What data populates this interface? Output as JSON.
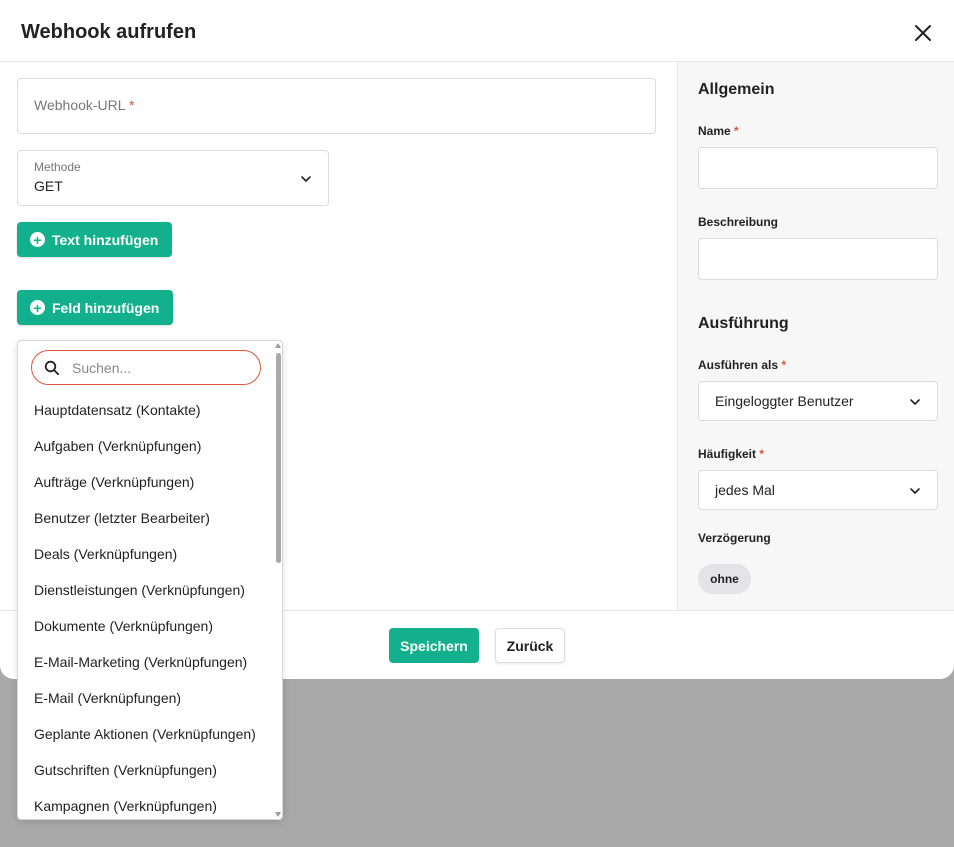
{
  "dialog": {
    "title": "Webhook aufrufen"
  },
  "main": {
    "url_label": "Webhook-URL",
    "required_mark": "*",
    "method_label": "Methode",
    "method_value": "GET",
    "add_text_label": "Text hinzufügen",
    "add_field_label": "Feld hinzufügen"
  },
  "dropdown": {
    "search_placeholder": "Suchen...",
    "options": [
      "Hauptdatensatz (Kontakte)",
      "Aufgaben (Verknüpfungen)",
      "Aufträge (Verknüpfungen)",
      "Benutzer (letzter Bearbeiter)",
      "Deals (Verknüpfungen)",
      "Dienstleistungen (Verknüpfungen)",
      "Dokumente (Verknüpfungen)",
      "E-Mail-Marketing (Verknüpfungen)",
      "E-Mail (Verknüpfungen)",
      "Geplante Aktionen (Verknüpfungen)",
      "Gutschriften (Verknüpfungen)",
      "Kampagnen (Verknüpfungen)"
    ]
  },
  "sidebar": {
    "general_heading": "Allgemein",
    "name_label": "Name",
    "description_label": "Beschreibung",
    "execution_heading": "Ausführung",
    "run_as_label": "Ausführen als",
    "run_as_value": "Eingeloggter Benutzer",
    "frequency_label": "Häufigkeit",
    "frequency_value": "jedes Mal",
    "delay_label": "Verzögerung",
    "delay_value": "ohne"
  },
  "footer": {
    "save_label": "Speichern",
    "back_label": "Zurück"
  },
  "colors": {
    "accent": "#12b08c",
    "required": "#e0533a",
    "overlay": "#a8a8a8"
  }
}
